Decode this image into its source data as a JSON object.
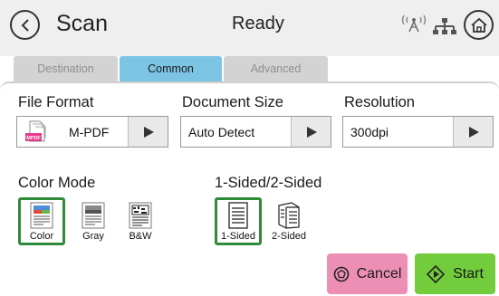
{
  "header": {
    "title": "Scan",
    "status": "Ready"
  },
  "tabs": [
    {
      "label": "Destination",
      "active": false
    },
    {
      "label": "Common",
      "active": true
    },
    {
      "label": "Advanced",
      "active": false
    }
  ],
  "file_format": {
    "label": "File Format",
    "value": "M-PDF",
    "icon_text": "MPDF"
  },
  "document_size": {
    "label": "Document Size",
    "value": "Auto Detect"
  },
  "resolution": {
    "label": "Resolution",
    "value": "300dpi"
  },
  "color_mode": {
    "label": "Color Mode",
    "options": [
      {
        "label": "Color",
        "selected": true
      },
      {
        "label": "Gray",
        "selected": false
      },
      {
        "label": "B&W",
        "selected": false
      }
    ]
  },
  "sided": {
    "label": "1-Sided/2-Sided",
    "options": [
      {
        "label": "1-Sided",
        "selected": true
      },
      {
        "label": "2-Sided",
        "selected": false
      }
    ]
  },
  "actions": {
    "cancel_label": "Cancel",
    "start_label": "Start"
  },
  "colors": {
    "active_tab": "#7cc4e3",
    "inactive_tab": "#d3d3d3",
    "selected_border": "#2f8a3a",
    "cancel": "#ed8fb4",
    "start": "#72cc3c"
  }
}
